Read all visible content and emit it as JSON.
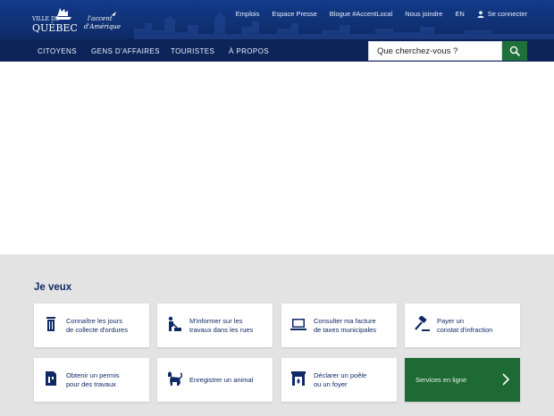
{
  "header": {
    "logo": {
      "line1": "VILLE DE",
      "line2": "QUÉBEC",
      "tagline1": "l'accent",
      "tagline2": "d'Amérique"
    },
    "top_links": [
      "Emplois",
      "Espace Presse",
      "Blogue #AccentLocal",
      "Nous joindre",
      "EN"
    ],
    "login_label": "Se connecter"
  },
  "nav": {
    "items": [
      "CITOYENS",
      "GENS D'AFFAIRES",
      "TOURISTES",
      "À PROPOS"
    ]
  },
  "search": {
    "placeholder": "Que cherchez-vous ?"
  },
  "services": {
    "title": "Je veux",
    "cards": [
      {
        "line1": "Connaître les jours",
        "line2": "de collecte d'ordures",
        "icon": "trash-icon"
      },
      {
        "line1": "M'informer sur les",
        "line2": "travaux dans les rues",
        "icon": "worker-icon"
      },
      {
        "line1": "Consulter ma facture",
        "line2": "de taxes municipales",
        "icon": "laptop-icon"
      },
      {
        "line1": "Payer un",
        "line2": "constat d'infraction",
        "icon": "gavel-icon"
      },
      {
        "line1": "Obtenir un permis",
        "line2": "pour des travaux",
        "icon": "permit-icon"
      },
      {
        "line1": "Enregistrer un animal",
        "line2": "",
        "icon": "cat-icon"
      },
      {
        "line1": "Déclarer un poêle",
        "line2": "ou un foyer",
        "icon": "fireplace-icon"
      }
    ],
    "online_label": "Services en ligne"
  },
  "colors": {
    "navy": "#0f2a66",
    "green": "#1e6a35",
    "gray_bg": "#e3e3e3"
  }
}
